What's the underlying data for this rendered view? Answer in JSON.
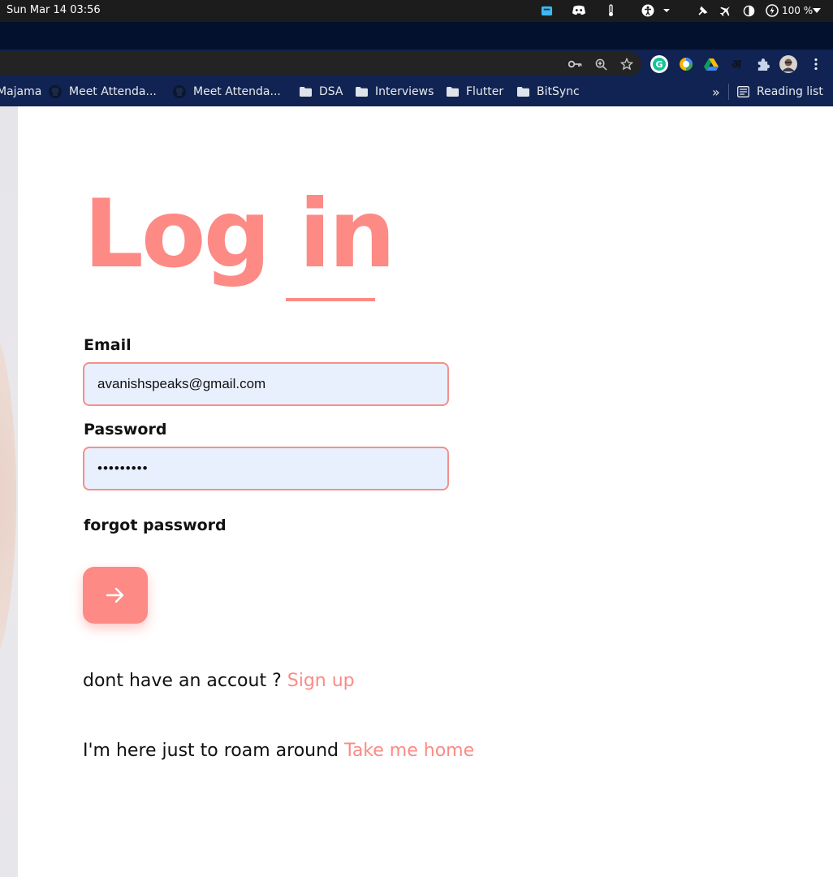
{
  "os_bar": {
    "clock": "Sun Mar 14  03:56",
    "battery": "100 %",
    "icons": [
      "tracker-icon",
      "discord-icon",
      "thermometer-icon",
      "accessibility-icon",
      "pin-icon",
      "airplane-icon",
      "contrast-icon",
      "power-icon"
    ]
  },
  "browser": {
    "toolbar_icons": [
      "key-icon",
      "zoom-icon",
      "star-icon"
    ],
    "extensions": [
      "grammarly-icon",
      "clock-extension-icon",
      "drive-icon",
      "hindi-input-icon",
      "puzzle-icon",
      "profile-avatar",
      "menu-dots-icon"
    ],
    "bookmarks": [
      {
        "label": "Majama",
        "icon": "none"
      },
      {
        "label": "Meet Attenda...",
        "icon": "github-icon"
      },
      {
        "label": "Meet Attenda...",
        "icon": "github-icon"
      },
      {
        "label": "DSA",
        "icon": "folder-icon"
      },
      {
        "label": "Interviews",
        "icon": "folder-icon"
      },
      {
        "label": "Flutter",
        "icon": "folder-icon"
      },
      {
        "label": "BitSync",
        "icon": "folder-icon"
      }
    ],
    "overflow": "»",
    "reading_list": "Reading list"
  },
  "login": {
    "title": "Log in",
    "email_label": "Email",
    "email_value": "avanishspeaks@gmail.com",
    "password_label": "Password",
    "password_value": "•••••••••",
    "forgot": "forgot password",
    "signup_prompt": "dont have an accout ?",
    "signup_link": "Sign up",
    "roam_prompt": "I'm here just to roam around",
    "roam_link": "Take me home"
  },
  "colors": {
    "accent": "#fd8a84",
    "input_bg": "#e8f0fe",
    "chrome_bg": "#102352",
    "os_bar": "#1c1c1c"
  }
}
